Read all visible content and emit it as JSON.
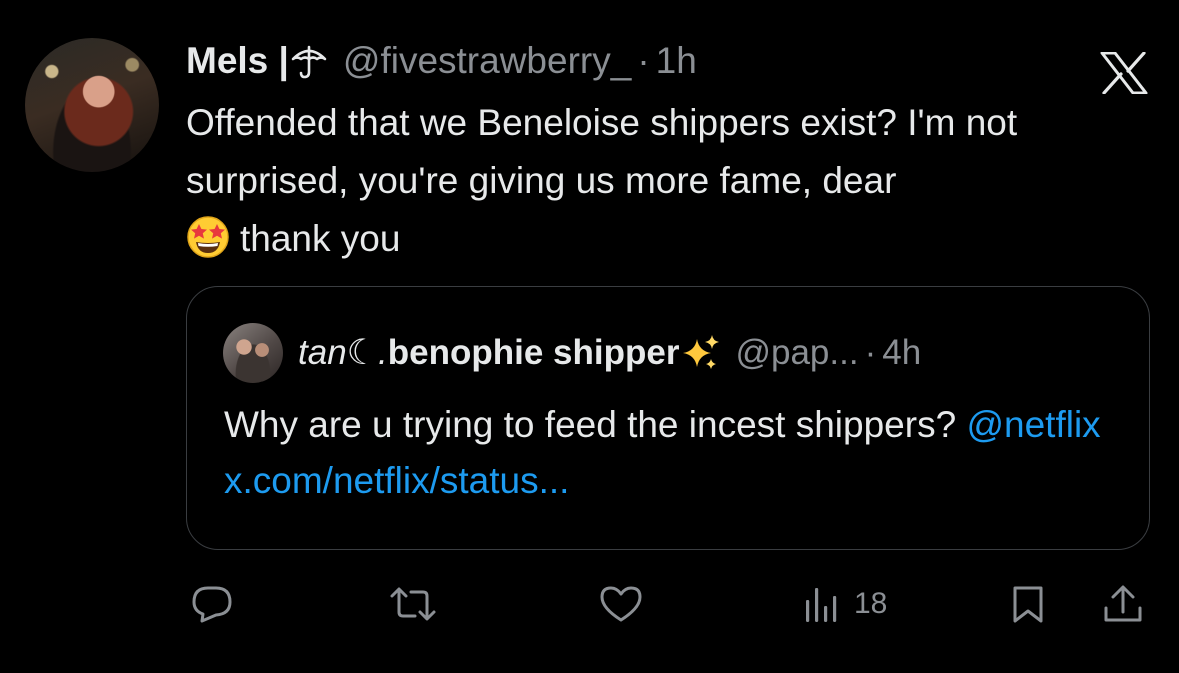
{
  "author": {
    "name": "Mels |",
    "handle": "@fivestrawberry_",
    "dot": "·",
    "time": "1h"
  },
  "tweet_text": {
    "line_main": "Offended that we Beneloise shippers exist? I'm not surprised, you're giving us more fame, dear",
    "line_end": "thank you"
  },
  "quoted": {
    "name_prefix": "tan☾.",
    "name_main": " benophie shipper",
    "handle": "@pap...",
    "dot": "·",
    "time": "4h",
    "text": "Why are u trying to feed the incest shippers?",
    "mention": "@netflix",
    "link": "x.com/netflix/status..."
  },
  "actions": {
    "views_count": "18"
  },
  "colors": {
    "background": "#000000",
    "text": "#e7e9ea",
    "muted": "#8b8f94",
    "link": "#1d9bf0",
    "border": "#3a3d41"
  },
  "icons": {
    "author_name_icon": "umbrella-icon",
    "brand": "x-logo-icon",
    "emoji": "star-struck-emoji",
    "quoted_name_icon": "sparkles-icon",
    "action_icons": [
      "reply-icon",
      "retweet-icon",
      "like-icon",
      "views-icon",
      "bookmark-icon",
      "share-icon"
    ]
  }
}
